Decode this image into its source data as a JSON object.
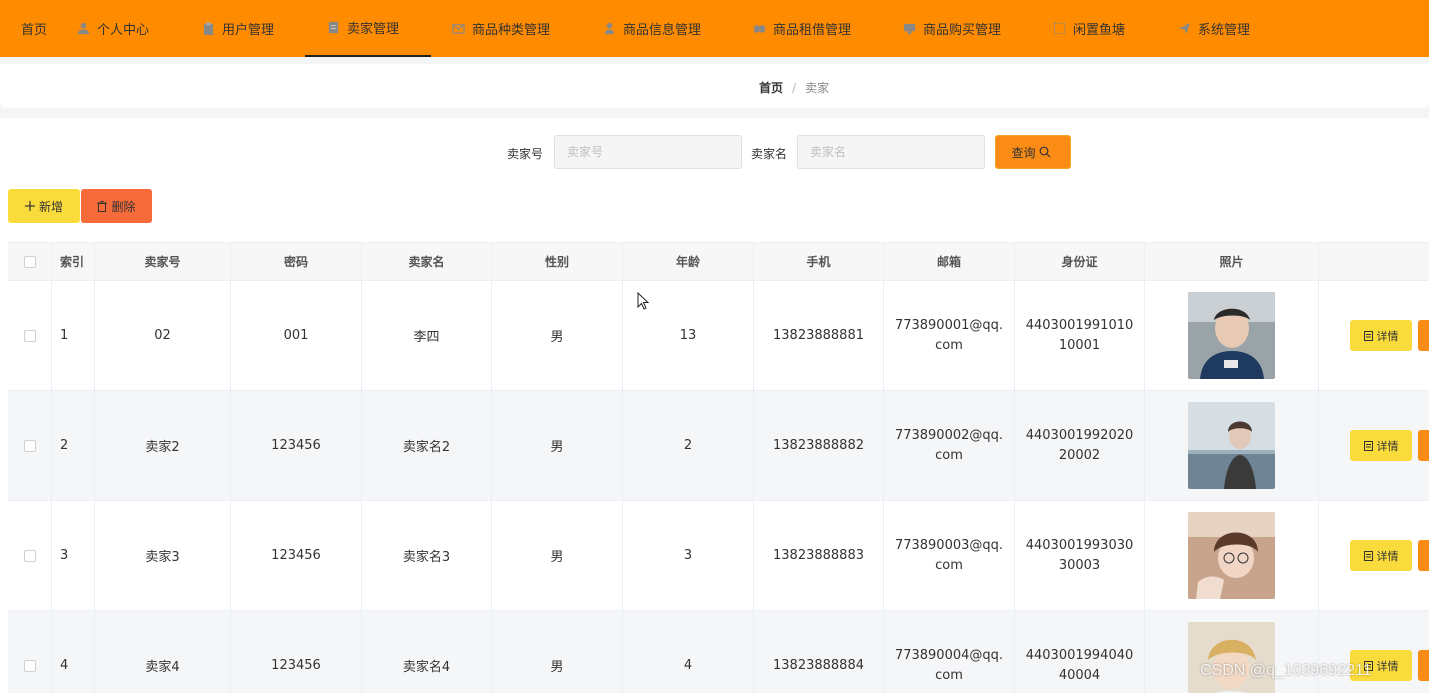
{
  "nav": {
    "items": [
      {
        "label": "首页",
        "icon": "home-icon"
      },
      {
        "label": "个人中心",
        "icon": "user-icon"
      },
      {
        "label": "用户管理",
        "icon": "clipboard-icon"
      },
      {
        "label": "卖家管理",
        "icon": "document-icon"
      },
      {
        "label": "商品种类管理",
        "icon": "mail-icon"
      },
      {
        "label": "商品信息管理",
        "icon": "person-icon"
      },
      {
        "label": "商品租借管理",
        "icon": "handshake-icon"
      },
      {
        "label": "商品购买管理",
        "icon": "monitor-icon"
      },
      {
        "label": "闲置鱼塘",
        "icon": "frame-icon"
      },
      {
        "label": "系统管理",
        "icon": "send-icon"
      }
    ],
    "active_index": 3,
    "bg_color": "#ff8c00"
  },
  "breadcrumb": {
    "home": "首页",
    "separator": "/",
    "current": "卖家"
  },
  "search": {
    "seller_no_label": "卖家号",
    "seller_no_placeholder": "卖家号",
    "seller_name_label": "卖家名",
    "seller_name_placeholder": "卖家名",
    "query_label": "查询"
  },
  "actions": {
    "add_label": "新增",
    "delete_label": "删除"
  },
  "table": {
    "headers": [
      "索引",
      "卖家号",
      "密码",
      "卖家名",
      "性别",
      "年龄",
      "手机",
      "邮箱",
      "身份证",
      "照片"
    ],
    "rows": [
      {
        "index": "1",
        "seller_no": "02",
        "password": "001",
        "name": "李四",
        "gender": "男",
        "age": "13",
        "phone": "13823888881",
        "email": "773890001@qq.com",
        "id_card": "440300199101010001",
        "photo": "photo-young-man",
        "detail_label": "详情"
      },
      {
        "index": "2",
        "seller_no": "卖家2",
        "password": "123456",
        "name": "卖家名2",
        "gender": "男",
        "age": "2",
        "phone": "13823888882",
        "email": "773890002@qq.com",
        "id_card": "440300199202020002",
        "photo": "photo-woman-seaside",
        "detail_label": "详情"
      },
      {
        "index": "3",
        "seller_no": "卖家3",
        "password": "123456",
        "name": "卖家名3",
        "gender": "男",
        "age": "3",
        "phone": "13823888883",
        "email": "773890003@qq.com",
        "id_card": "440300199303030003",
        "photo": "photo-woman-glasses",
        "detail_label": "详情"
      },
      {
        "index": "4",
        "seller_no": "卖家4",
        "password": "123456",
        "name": "卖家名4",
        "gender": "男",
        "age": "4",
        "phone": "13823888884",
        "email": "773890004@qq.com",
        "id_card": "440300199404040004",
        "photo": "photo-blond-man",
        "detail_label": "详情"
      }
    ]
  },
  "watermark": "CSDN @q_1039692211"
}
